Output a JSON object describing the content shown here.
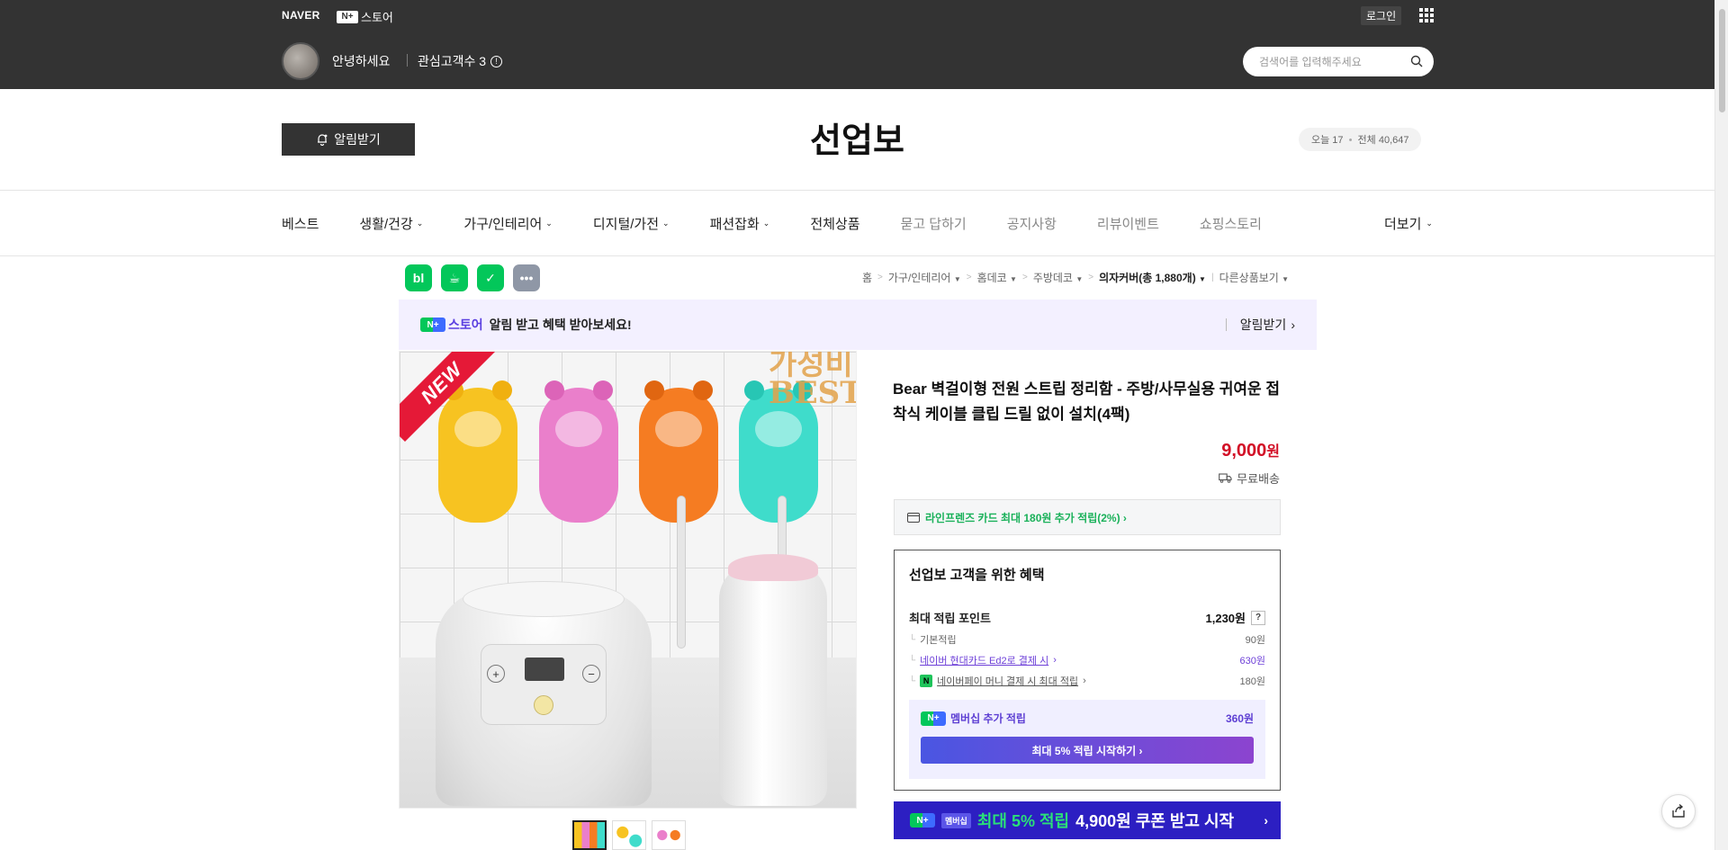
{
  "header": {
    "naver_logo": "NAVER",
    "nstore_badge": "N+",
    "nstore_label": "스토어",
    "login": "로그인",
    "greeting": "안녕하세요",
    "fans": "관심고객수 3",
    "search_placeholder": "검색어를 입력해주세요"
  },
  "store": {
    "alarm_button": "알림받기",
    "title": "선업보",
    "today_label": "오늘 17",
    "dot": "•",
    "total_label": "전체 40,647"
  },
  "nav": {
    "items": [
      {
        "label": "베스트",
        "dropdown": false
      },
      {
        "label": "생활/건강",
        "dropdown": true
      },
      {
        "label": "가구/인테리어",
        "dropdown": true
      },
      {
        "label": "디지털/가전",
        "dropdown": true
      },
      {
        "label": "패션잡화",
        "dropdown": true
      },
      {
        "label": "전체상품",
        "dropdown": false
      },
      {
        "label": "묻고 답하기",
        "dropdown": false
      },
      {
        "label": "공지사항",
        "dropdown": false
      },
      {
        "label": "리뷰이벤트",
        "dropdown": false
      },
      {
        "label": "쇼핑스토리",
        "dropdown": false
      }
    ],
    "more": "더보기"
  },
  "share": {
    "blog": "bl",
    "cafe": "☕",
    "bookmark": "✓",
    "more": "•••"
  },
  "breadcrumb": {
    "home": "홈",
    "c1": "가구/인테리어",
    "c2": "홈데코",
    "c3": "주방데코",
    "current": "의자커버(총 1,880개)",
    "other": "다른상품보기"
  },
  "promo": {
    "badge": "N+",
    "store": "스토어",
    "text": "알림 받고 혜택 받아보세요!",
    "action": "알림받기"
  },
  "image": {
    "new_badge": "NEW",
    "overlay_line1": "가성비",
    "overlay_line2": "BEST",
    "plus": "+",
    "minus": "−"
  },
  "product": {
    "title": "Bear 벽걸이형 전원 스트립 정리함 - 주방/사무실용 귀여운 접착식 케이블 클립 드릴 없이 설치(4팩)",
    "price": "9,000",
    "price_unit": "원",
    "shipping": "무료배송",
    "card_benefit": "라인프렌즈 카드 최대 180원 추가 적립(2%) ›"
  },
  "benefits": {
    "title": "선업보 고객을 위한 혜택",
    "max_points_label": "최대 적립 포인트",
    "max_points_value": "1,230원",
    "help": "?",
    "tree": "└",
    "basic_label": "기본적립",
    "basic_value": "90원",
    "card_label": "네이버 현대카드 Ed2로 결제 시",
    "card_value": "630원",
    "npay_icon": "N",
    "npay_label": "네이버페이 머니 결제 시 최대 적립",
    "npay_value": "180원",
    "member_badge": "N+",
    "member_label": "멤버십 추가 적립",
    "member_value": "360원",
    "member_button": "최대 5% 적립 시작하기 ›"
  },
  "coupon": {
    "badge": "N+",
    "member": "멤버십",
    "text_green": "최대 5% 적립",
    "text_white": "4,900원 쿠폰 받고 시작",
    "arrow": "›"
  },
  "colors": {
    "header_bg": "#333333",
    "price": "#d20f26",
    "naver_green": "#03c75a",
    "membership_purple": "#5d3fd3",
    "coupon_bg": "#2c1fc2"
  }
}
